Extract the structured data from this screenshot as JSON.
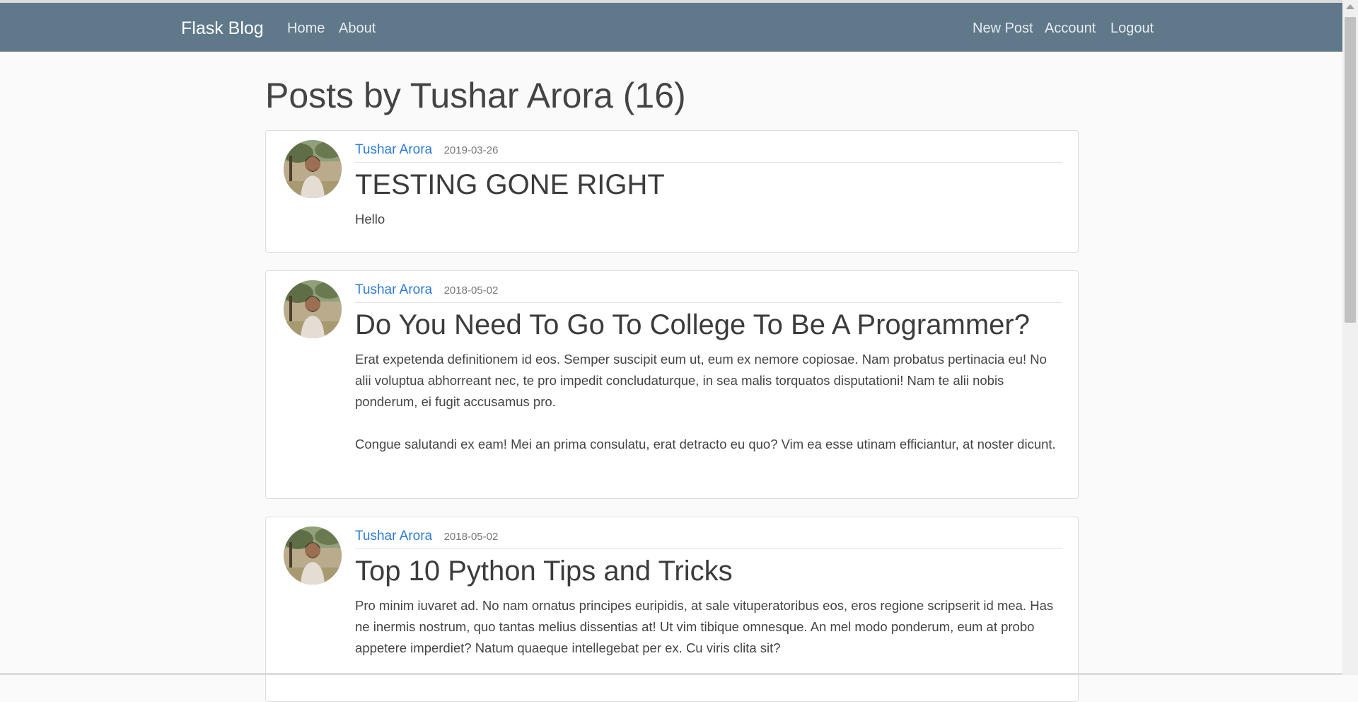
{
  "navbar": {
    "brand": "Flask Blog",
    "left_links": [
      "Home",
      "About"
    ],
    "right_links": [
      "New Post",
      "Account",
      "Logout"
    ]
  },
  "page": {
    "title": "Posts by Tushar Arora (16)"
  },
  "posts": [
    {
      "author": "Tushar Arora",
      "date": "2019-03-26",
      "title": "TESTING GONE RIGHT",
      "paragraphs": [
        "Hello"
      ]
    },
    {
      "author": "Tushar Arora",
      "date": "2018-05-02",
      "title": "Do You Need To Go To College To Be A Programmer?",
      "paragraphs": [
        "Erat expetenda definitionem id eos. Semper suscipit eum ut, eum ex nemore copiosae. Nam probatus pertinacia eu! No alii voluptua abhorreant nec, te pro impedit concludaturque, in sea malis torquatos disputationi! Nam te alii nobis ponderum, ei fugit accusamus pro.",
        "Congue salutandi ex eam! Mei an prima consulatu, erat detracto eu quo? Vim ea esse utinam efficiantur, at noster dicunt."
      ]
    },
    {
      "author": "Tushar Arora",
      "date": "2018-05-02",
      "title": "Top 10 Python Tips and Tricks",
      "paragraphs": [
        "Pro minim iuvaret ad. No nam ornatus principes euripidis, at sale vituperatoribus eos, eros regione scripserit id mea. Has ne inermis nostrum, quo tantas melius dissentias at! Ut vim tibique omnesque. An mel modo ponderum, eum at probo appetere imperdiet? Natum quaeque intellegebat per ex. Cu viris clita sit?"
      ]
    }
  ],
  "colors": {
    "navbar_bg": "#5f788a",
    "link": "#2b7bd6",
    "page_bg": "#fafafa"
  },
  "icons": {
    "avatar": "profile-photo"
  }
}
